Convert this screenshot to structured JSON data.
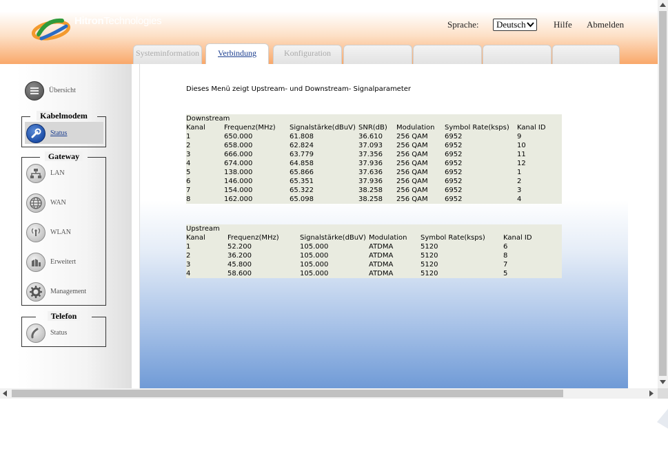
{
  "header": {
    "brand_bold": "Hitron",
    "brand_rest": "Technologies",
    "language_label": "Sprache:",
    "language_selected": "Deutsch",
    "help": "Hilfe",
    "logout": "Abmelden"
  },
  "tabs": [
    {
      "label": "Systeminformation",
      "active": false
    },
    {
      "label": "Verbindung",
      "active": true
    },
    {
      "label": "Konfiguration",
      "active": false
    },
    {
      "label": "",
      "active": false
    },
    {
      "label": "",
      "active": false
    },
    {
      "label": "",
      "active": false
    },
    {
      "label": "",
      "active": false
    }
  ],
  "sidebar": {
    "overview": "Übersicht",
    "cable_modem": {
      "title": "Kabelmodem",
      "items": [
        {
          "label": "Status",
          "icon": "wrench-icon"
        }
      ]
    },
    "gateway": {
      "title": "Gateway",
      "items": [
        {
          "label": "LAN",
          "icon": "lan-icon"
        },
        {
          "label": "WAN",
          "icon": "globe-icon"
        },
        {
          "label": "WLAN",
          "icon": "wireless-icon"
        },
        {
          "label": "Erweitert",
          "icon": "advanced-icon"
        },
        {
          "label": "Management",
          "icon": "gear-icon"
        }
      ]
    },
    "telephone": {
      "title": "Telefon",
      "items": [
        {
          "label": "Status",
          "icon": "phone-icon"
        }
      ]
    }
  },
  "content": {
    "intro": "Dieses Menü zeigt Upstream- und Downstream- Signalparameter",
    "downstream": {
      "title": "Downstream",
      "columns": [
        "Kanal",
        "Frequenz(MHz)",
        "Signalstärke(dBuV)",
        "SNR(dB)",
        "Modulation",
        "Symbol Rate(ksps)",
        "Kanal ID"
      ],
      "rows": [
        [
          "1",
          "650.000",
          "61.808",
          "36.610",
          "256 QAM",
          "6952",
          "9"
        ],
        [
          "2",
          "658.000",
          "62.824",
          "37.093",
          "256 QAM",
          "6952",
          "10"
        ],
        [
          "3",
          "666.000",
          "63.779",
          "37.356",
          "256 QAM",
          "6952",
          "11"
        ],
        [
          "4",
          "674.000",
          "64.858",
          "37.936",
          "256 QAM",
          "6952",
          "12"
        ],
        [
          "5",
          "138.000",
          "65.866",
          "37.636",
          "256 QAM",
          "6952",
          "1"
        ],
        [
          "6",
          "146.000",
          "65.351",
          "37.936",
          "256 QAM",
          "6952",
          "2"
        ],
        [
          "7",
          "154.000",
          "65.322",
          "38.258",
          "256 QAM",
          "6952",
          "3"
        ],
        [
          "8",
          "162.000",
          "65.098",
          "38.258",
          "256 QAM",
          "6952",
          "4"
        ]
      ]
    },
    "upstream": {
      "title": "Upstream",
      "columns": [
        "Kanal",
        "Frequenz(MHz)",
        "Signalstärke(dBuV)",
        "Modulation",
        "Symbol Rate(ksps)",
        "Kanal ID"
      ],
      "rows": [
        [
          "1",
          "52.200",
          "105.000",
          "ATDMA",
          "5120",
          "6"
        ],
        [
          "2",
          "36.200",
          "105.000",
          "ATDMA",
          "5120",
          "8"
        ],
        [
          "3",
          "45.800",
          "105.000",
          "ATDMA",
          "5120",
          "7"
        ],
        [
          "4",
          "58.600",
          "105.000",
          "ATDMA",
          "5120",
          "5"
        ]
      ]
    }
  },
  "colors": {
    "accent_orange": "#f9a86a",
    "link_blue": "#1a3d8f",
    "panel_bg": "#e9ebe0"
  }
}
